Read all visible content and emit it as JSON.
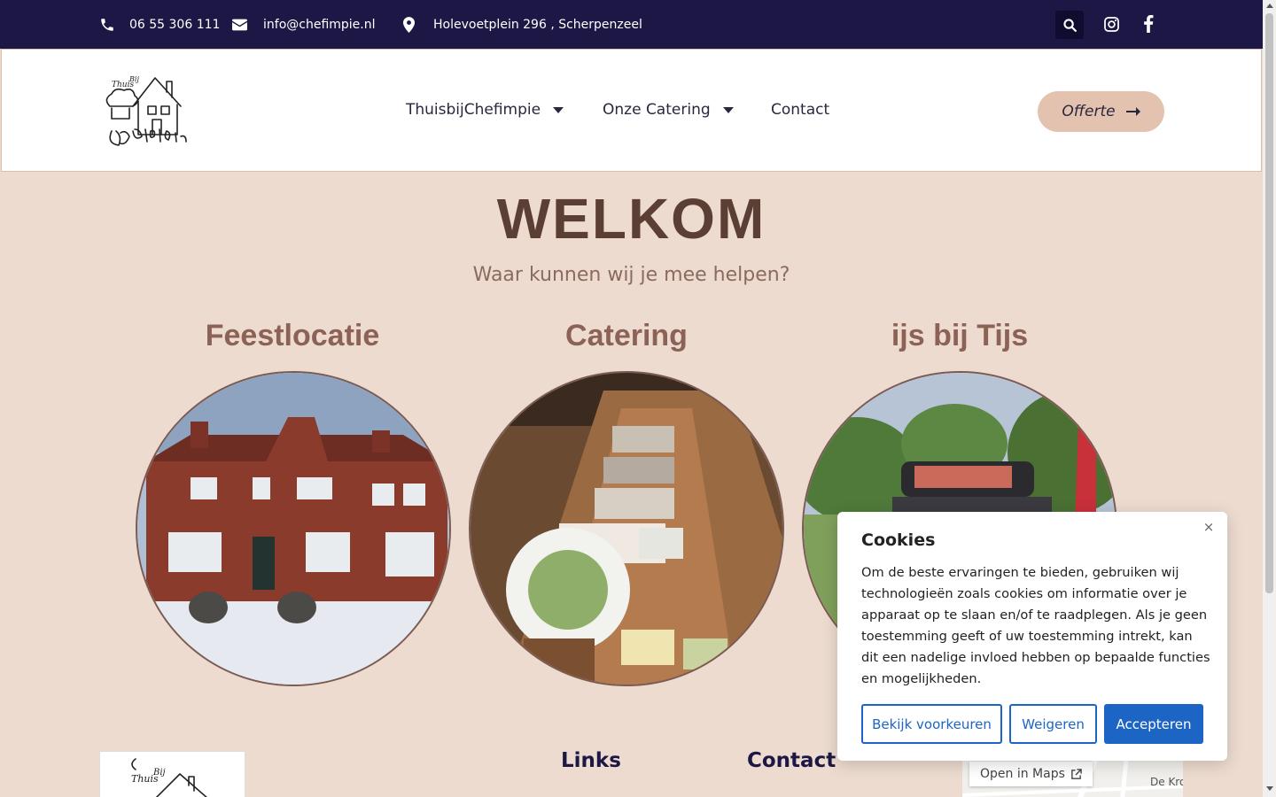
{
  "topbar": {
    "phone": "06 55 306 111",
    "email": "info@chefimpie.nl",
    "address": "Holevoetplein 296 , Scherpenzeel",
    "icons": [
      "phone-icon",
      "envelope-icon",
      "map-pin-icon",
      "search-icon",
      "instagram-icon",
      "facebook-icon"
    ],
    "background": "#1c1744"
  },
  "header": {
    "logo_text": "Thuis Bij CHEFIMPIE",
    "nav": [
      {
        "label": "ThuisbijChefimpie",
        "has_dropdown": true
      },
      {
        "label": "Onze Catering",
        "has_dropdown": true
      },
      {
        "label": "Contact",
        "has_dropdown": false
      }
    ],
    "cta_label": "Offerte"
  },
  "hero": {
    "title": "WELKOM",
    "subtitle": "Waar kunnen wij je mee helpen?"
  },
  "cards": [
    {
      "title": "Feestlocatie",
      "image": "brick-house-photo"
    },
    {
      "title": "Catering",
      "image": "buffet-photo"
    },
    {
      "title": "ijs bij Tijs",
      "image": "ice-cream-cart-photo"
    }
  ],
  "footer": {
    "links_heading": "Links",
    "contact_heading": "Contact",
    "map_button": "Open in Maps",
    "map_labels": [
      "De Kro"
    ]
  },
  "cookie": {
    "title": "Cookies",
    "close": "×",
    "body": "Om de beste ervaringen te bieden, gebruiken wij technologieën zoals cookies om informatie over je apparaat op te slaan en/of te raadplegen. Als je geen toestemming geeft of uw toestemming intrekt, kan dit een nadelige invloed hebben op bepaalde functies en mogelijkheden.",
    "btn_prefs": "Bekijk voorkeuren",
    "btn_deny": "Weigeren",
    "btn_accept": "Accepteren",
    "accent": "#1d65c5"
  },
  "colors": {
    "page_bg": "#eddbcf",
    "heading": "#5b3f35",
    "card_title": "#8b6255",
    "cta_bg": "#e3c2af"
  }
}
